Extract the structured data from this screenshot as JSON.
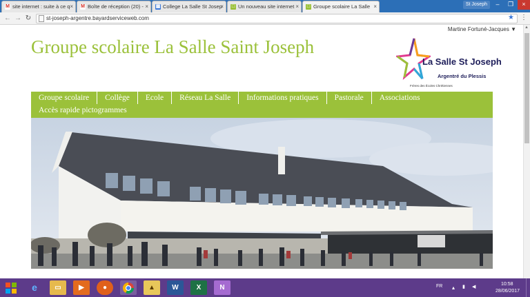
{
  "browser": {
    "tabs": [
      {
        "label": "site internet : suite à ce q",
        "icon": "gmail-icon"
      },
      {
        "label": "Boîte de réception (20) -",
        "icon": "gmail-icon"
      },
      {
        "label": "College La Salle St Josep",
        "icon": "calendar-icon"
      },
      {
        "label": "Un nouveau site internet",
        "icon": "site-icon"
      },
      {
        "label": "Groupe scolaire La Salle",
        "icon": "site-icon"
      }
    ],
    "profile_label": "St Joseph",
    "url": "st-joseph-argentre.bayardserviceweb.com"
  },
  "page": {
    "user_name": "Martine Fortuné-Jacques ▼",
    "site_title": "Groupe scolaire La Salle Saint Joseph",
    "logo": {
      "name": "La Salle St Joseph",
      "subtitle": "Argentré du Plessis",
      "tagline": "Frères des Écoles Chrétiennes"
    },
    "nav_row1": [
      "Groupe scolaire",
      "Collège",
      "Ecole",
      "Réseau La Salle",
      "Informations pratiques",
      "Pastorale",
      "Associations"
    ],
    "nav_row2": [
      "Accès rapide pictogrammes"
    ]
  },
  "taskbar": {
    "language": "FR",
    "time": "10:58",
    "date": "28/06/2017"
  },
  "colors": {
    "accent_green": "#9bc13a",
    "taskbar_purple": "#5d3b8a",
    "tabbar_blue": "#2c6fb7"
  }
}
